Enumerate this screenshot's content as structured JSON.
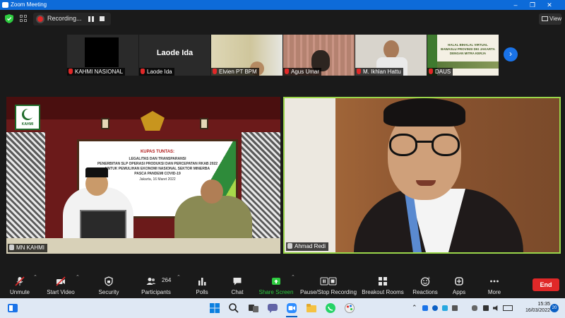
{
  "window": {
    "title": "Zoom Meeting"
  },
  "topbar": {
    "recording_label": "Recording...",
    "view_label": "View"
  },
  "thumbnails": [
    {
      "name": "KAHMI NASIONAL"
    },
    {
      "name": "Laode Ida",
      "big_name": "Laode Ida"
    },
    {
      "name": "Elvien PT BPM"
    },
    {
      "name": "Agus Umar"
    },
    {
      "name": "M. Ikhlan Hattu"
    },
    {
      "name": "DAUS",
      "banner_lines": [
        "HALAL BIHALAL VIRTUAL",
        "BAWASLU PROVINSI DKI JAKARTA",
        "DENGAN MITRA KERJA"
      ]
    }
  ],
  "main": {
    "left": {
      "name": "MN KAHMI",
      "logo_text": "KAHMI",
      "banner": {
        "title": "KUPAS TUNTAS:",
        "lines": [
          "LEGALITAS DAN TRANSPARANSI",
          "PENERBITAN SLP OPERASI PRODUKSI DAN PERCEPATAN RKAB 2022",
          "UNTUK PEMULIHAN EKONOMI NASIONAL SEKTOR MINERBA",
          "PASCA PANDEMI COVID-19"
        ],
        "date": "Jakarta, 16 Maret 2022"
      }
    },
    "right": {
      "name": "Ahmad Redi"
    }
  },
  "toolbar": {
    "unmute": "Unmute",
    "start_video": "Start Video",
    "security": "Security",
    "participants": "Participants",
    "participants_count": "264",
    "polls": "Polls",
    "chat": "Chat",
    "share_screen": "Share Screen",
    "pause_stop": "Pause/Stop Recording",
    "breakout": "Breakout Rooms",
    "reactions": "Reactions",
    "apps": "Apps",
    "more": "More",
    "end": "End"
  },
  "taskbar": {
    "time": "15:35",
    "date": "16/03/2022",
    "notifications": "20"
  },
  "colors": {
    "accent": "#0d6bd9",
    "end": "#e02828",
    "share": "#2ecc40",
    "speaker_border": "#9ad64a"
  }
}
